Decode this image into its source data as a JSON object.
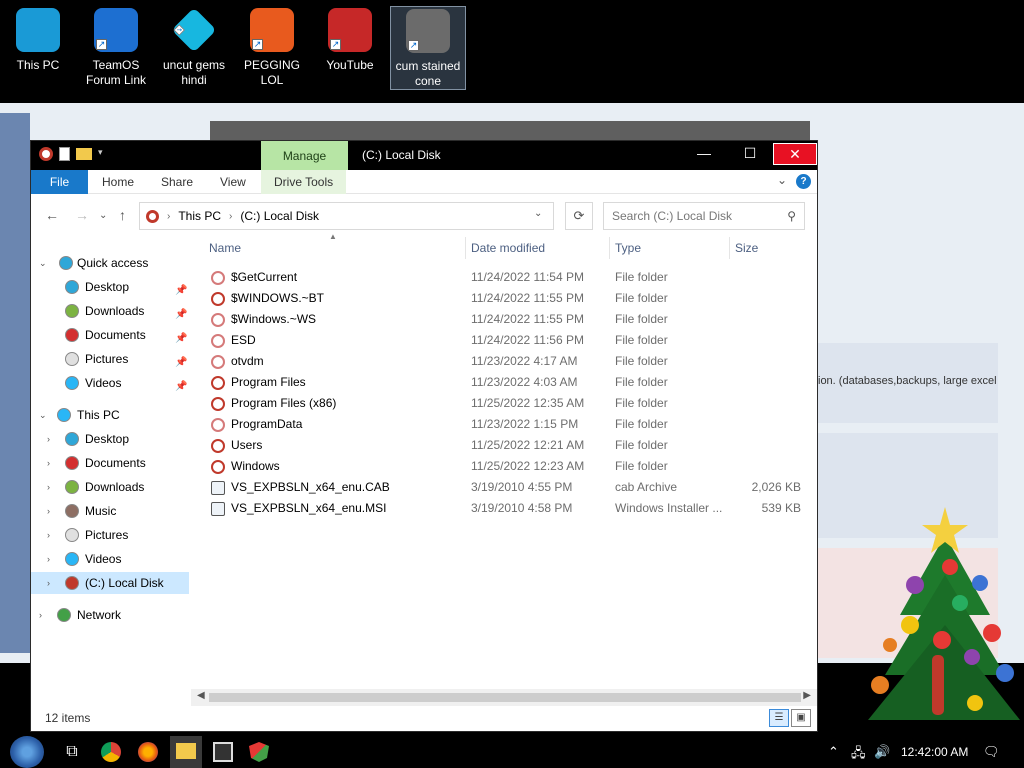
{
  "desktop_icons": [
    {
      "label_lines": [
        "This PC"
      ],
      "icon": "monitor-icon"
    },
    {
      "label_lines": [
        "TeamOS",
        "Forum Link"
      ],
      "icon": "gear-icon"
    },
    {
      "label_lines": [
        "uncut gems",
        "hindi"
      ],
      "icon": "diamond-icon"
    },
    {
      "label_lines": [
        "PEGGING LOL"
      ],
      "icon": "letter-p-icon"
    },
    {
      "label_lines": [
        "YouTube"
      ],
      "icon": "angry-bird-icon"
    },
    {
      "label_lines": [
        "cum stained",
        "cone"
      ],
      "icon": "traffic-cone-icon"
    }
  ],
  "background_window": {
    "text": "ion. (databases,backups, large excel"
  },
  "window": {
    "title": "(C:) Local Disk",
    "context_tab": "Manage",
    "ribbon_tabs": [
      "File",
      "Home",
      "Share",
      "View",
      "Drive Tools"
    ],
    "breadcrumb": [
      "This PC",
      "(C:) Local Disk"
    ],
    "search_placeholder": "Search (C:) Local Disk",
    "colors": {
      "accent": "#1979ca",
      "manage_tab": "#b7e5a5",
      "selection": "#cce8ff",
      "close": "#e81123"
    }
  },
  "nav": {
    "quick_access": {
      "label": "Quick access",
      "items": [
        "Desktop",
        "Downloads",
        "Documents",
        "Pictures",
        "Videos"
      ]
    },
    "this_pc": {
      "label": "This PC",
      "items": [
        "Desktop",
        "Documents",
        "Downloads",
        "Music",
        "Pictures",
        "Videos",
        "(C:) Local Disk"
      ]
    },
    "network": "Network"
  },
  "columns": [
    "Name",
    "Date modified",
    "Type",
    "Size"
  ],
  "files": [
    {
      "name": "$GetCurrent",
      "date": "11/24/2022 11:54 PM",
      "type": "File folder",
      "size": ""
    },
    {
      "name": "$WINDOWS.~BT",
      "date": "11/24/2022 11:55 PM",
      "type": "File folder",
      "size": ""
    },
    {
      "name": "$Windows.~WS",
      "date": "11/24/2022 11:55 PM",
      "type": "File folder",
      "size": ""
    },
    {
      "name": "ESD",
      "date": "11/24/2022 11:56 PM",
      "type": "File folder",
      "size": ""
    },
    {
      "name": "otvdm",
      "date": "11/23/2022 4:17 AM",
      "type": "File folder",
      "size": ""
    },
    {
      "name": "Program Files",
      "date": "11/23/2022 4:03 AM",
      "type": "File folder",
      "size": ""
    },
    {
      "name": "Program Files (x86)",
      "date": "11/25/2022 12:35 AM",
      "type": "File folder",
      "size": ""
    },
    {
      "name": "ProgramData",
      "date": "11/23/2022 1:15 PM",
      "type": "File folder",
      "size": ""
    },
    {
      "name": "Users",
      "date": "11/25/2022 12:21 AM",
      "type": "File folder",
      "size": ""
    },
    {
      "name": "Windows",
      "date": "11/25/2022 12:23 AM",
      "type": "File folder",
      "size": ""
    },
    {
      "name": "VS_EXPBSLN_x64_enu.CAB",
      "date": "3/19/2010 4:55 PM",
      "type": "cab Archive",
      "size": "2,026 KB"
    },
    {
      "name": "VS_EXPBSLN_x64_enu.MSI",
      "date": "3/19/2010 4:58 PM",
      "type": "Windows Installer ...",
      "size": "539 KB"
    }
  ],
  "status": {
    "items": "12 items"
  },
  "taskbar": {
    "clock": "12:42:00 AM"
  }
}
